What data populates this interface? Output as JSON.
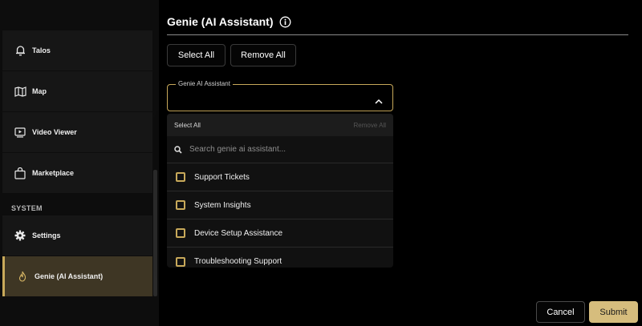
{
  "sidebar": {
    "items": [
      {
        "label": "Talos",
        "icon": "bell-icon"
      },
      {
        "label": "Map",
        "icon": "map-icon"
      },
      {
        "label": "Video Viewer",
        "icon": "video-icon"
      },
      {
        "label": "Marketplace",
        "icon": "shopping-bag-icon"
      }
    ],
    "section_label": "SYSTEM",
    "system_items": [
      {
        "label": "Settings",
        "icon": "gear-icon"
      },
      {
        "label": "Genie (AI Assistant)",
        "icon": "genie-flame-icon",
        "active": true
      }
    ]
  },
  "main": {
    "title": "Genie (AI Assistant)",
    "select_all_label": "Select All",
    "remove_all_label": "Remove All",
    "select_field": {
      "legend": "Genie AI Assistant",
      "value": ""
    },
    "dropdown": {
      "select_all_label": "Select All",
      "remove_all_label": "Remove All",
      "search_placeholder": "Search genie ai assistant...",
      "options": [
        {
          "label": "Support Tickets",
          "checked": false
        },
        {
          "label": "System Insights",
          "checked": false
        },
        {
          "label": "Device Setup Assistance",
          "checked": false
        },
        {
          "label": "Troubleshooting Support",
          "checked": false
        }
      ]
    }
  },
  "footer": {
    "cancel_label": "Cancel",
    "submit_label": "Submit"
  },
  "colors": {
    "accent": "#c8a95a",
    "submit_bg": "#d6bd7d",
    "active_bg": "#3e3624",
    "background": "#000000"
  }
}
